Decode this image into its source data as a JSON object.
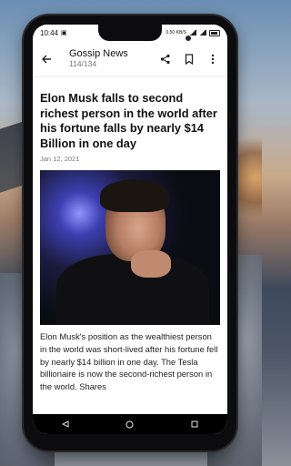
{
  "status": {
    "time": "10:44",
    "indicators": "0.50 KB/S"
  },
  "appbar": {
    "title": "Gossip News",
    "counter": "114/134",
    "icons": [
      "arrow-back-icon",
      "share-icon",
      "bookmark-icon",
      "more-vert-icon"
    ]
  },
  "article": {
    "headline": "Elon Musk falls to second richest person in the world after his fortune falls by nearly $14 Billion in one day",
    "date": "Jan 12, 2021",
    "body": "Elon Musk's position as the wealthiest person in the world was short-lived after his fortune fell by nearly $14 billion in one day.  The Tesla billionaire is now the second-richest person in the world. Shares"
  },
  "navbar": {
    "icons": [
      "back-triangle-icon",
      "home-circle-icon",
      "recents-square-icon"
    ]
  }
}
